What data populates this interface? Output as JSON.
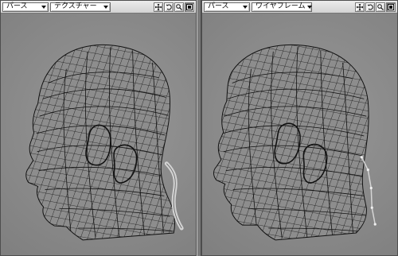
{
  "viewports": [
    {
      "view_mode": "パース",
      "shading_mode": "テクスチャー",
      "tools": [
        "move-icon",
        "rotate-icon",
        "zoom-icon",
        "maximize-icon"
      ],
      "content": "wireframe-head-textured-hair"
    },
    {
      "view_mode": "パース",
      "shading_mode": "ワイヤフレーム",
      "tools": [
        "move-icon",
        "rotate-icon",
        "zoom-icon",
        "maximize-icon"
      ],
      "content": "wireframe-head-with-bones"
    }
  ],
  "colors": {
    "wire": "#111111",
    "viewport_bg": "#8f8f8f",
    "toolbar_bg": "#dfdfdf"
  }
}
